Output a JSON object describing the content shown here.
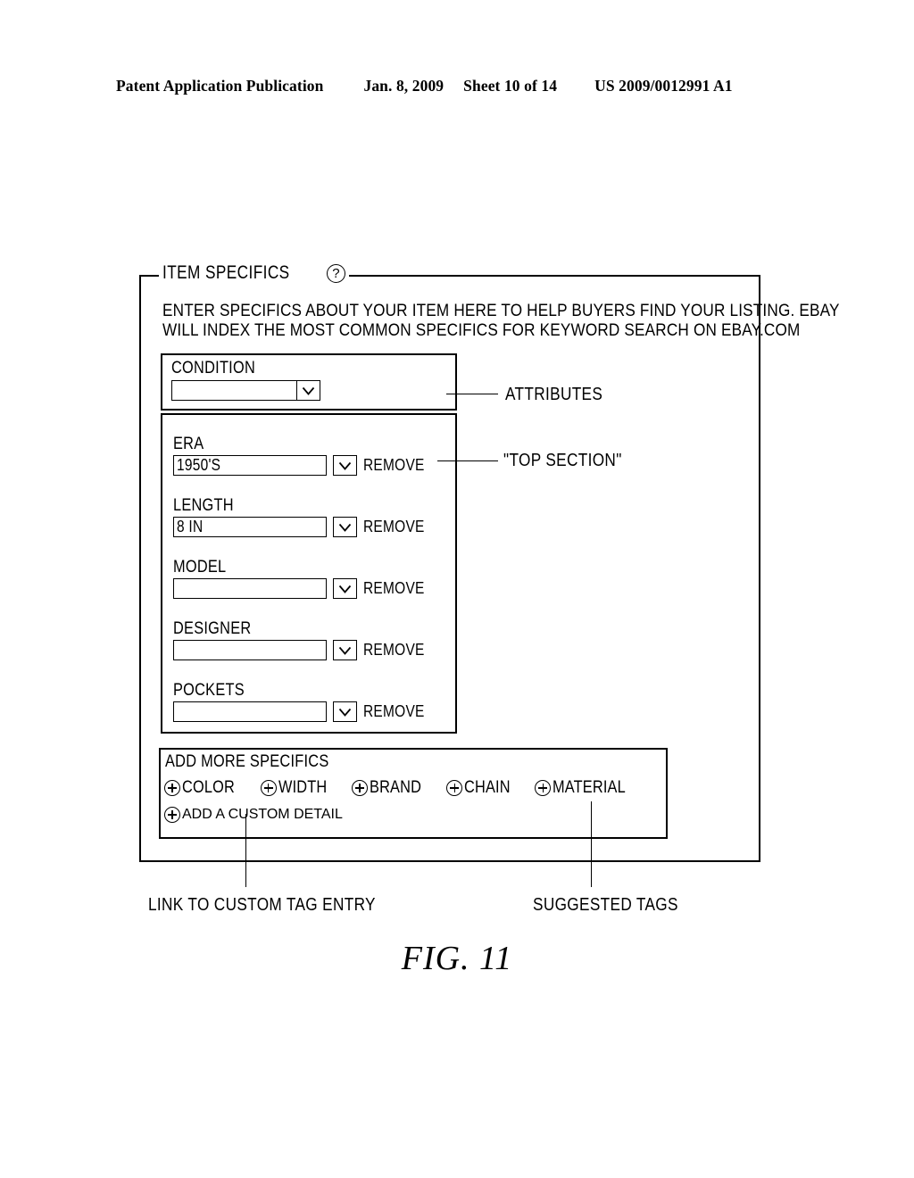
{
  "header": {
    "publication": "Patent Application Publication",
    "date": "Jan. 8, 2009",
    "sheet": "Sheet 10 of 14",
    "patent_number": "US 2009/0012991 A1"
  },
  "figure": {
    "caption": "FIG. 11",
    "legend": "ITEM SPECIFICS",
    "help_icon": "?",
    "intro_line1": "ENTER SPECIFICS ABOUT YOUR ITEM HERE TO HELP BUYERS FIND YOUR LISTING. EBAY",
    "intro_line2": "WILL INDEX THE MOST COMMON SPECIFICS FOR KEYWORD SEARCH ON EBAY.COM"
  },
  "condition": {
    "label": "CONDITION",
    "value": "",
    "placeholder": ""
  },
  "attributes": [
    {
      "label": "ERA",
      "value": "1950'S",
      "remove_label": "REMOVE"
    },
    {
      "label": "LENGTH",
      "value": "8 IN",
      "remove_label": "REMOVE"
    },
    {
      "label": "MODEL",
      "value": "",
      "remove_label": "REMOVE"
    },
    {
      "label": "DESIGNER",
      "value": "",
      "remove_label": "REMOVE"
    },
    {
      "label": "POCKETS",
      "value": "",
      "remove_label": "REMOVE"
    }
  ],
  "add_more": {
    "title": "ADD MORE SPECIFICS",
    "tags": [
      {
        "label": "COLOR"
      },
      {
        "label": "WIDTH"
      },
      {
        "label": "BRAND"
      },
      {
        "label": "CHAIN"
      },
      {
        "label": "MATERIAL"
      }
    ],
    "custom_detail": {
      "label": "ADD A CUSTOM DETAIL"
    }
  },
  "callouts": {
    "attributes": "ATTRIBUTES",
    "top_section": "\"TOP SECTION\"",
    "link_to_custom_tag_entry": "LINK TO CUSTOM TAG ENTRY",
    "suggested_tags": "SUGGESTED TAGS"
  },
  "icons": {
    "help": "help-circle-icon",
    "chevron": "chevron-down-icon",
    "plus": "plus-circle-icon"
  },
  "colors": {
    "ink": "#000000",
    "paper": "#ffffff"
  }
}
